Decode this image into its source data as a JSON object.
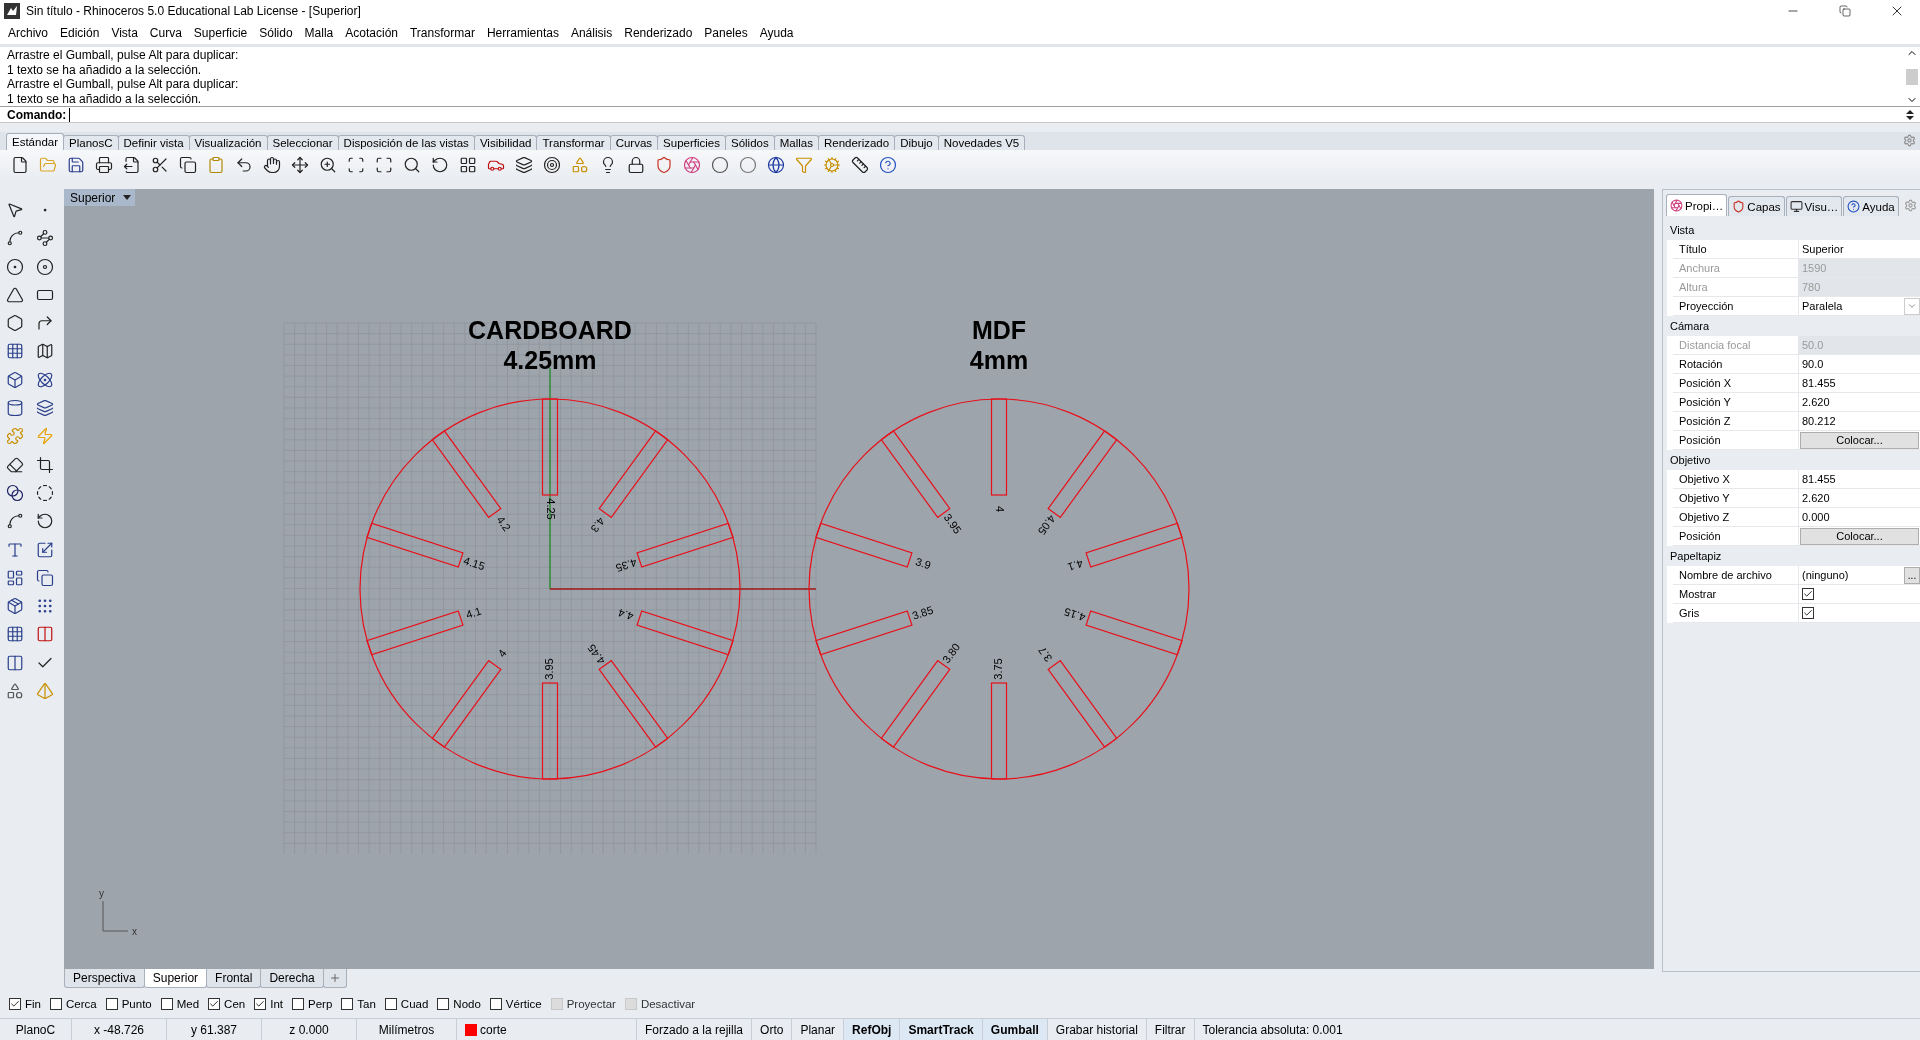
{
  "window": {
    "title": "Sin título - Rhinoceros 5.0 Educational Lab License - [Superior]"
  },
  "menu": [
    "Archivo",
    "Edición",
    "Vista",
    "Curva",
    "Superficie",
    "Sólido",
    "Malla",
    "Acotación",
    "Transformar",
    "Herramientas",
    "Análisis",
    "Renderizado",
    "Paneles",
    "Ayuda"
  ],
  "command_history": [
    "Arrastre el Gumball, pulse Alt para duplicar:",
    "1 texto se ha añadido a la selección.",
    "Arrastre el Gumball, pulse Alt para duplicar:",
    "1 texto se ha añadido a la selección."
  ],
  "command_prompt": "Comando:",
  "toolbar_tabs": [
    {
      "label": "Estándar",
      "selected": true
    },
    {
      "label": "PlanosC",
      "selected": false
    },
    {
      "label": "Definir vista",
      "selected": false
    },
    {
      "label": "Visualización",
      "selected": false
    },
    {
      "label": "Seleccionar",
      "selected": false
    },
    {
      "label": "Disposición de las vistas",
      "selected": false
    },
    {
      "label": "Visibilidad",
      "selected": false
    },
    {
      "label": "Transformar",
      "selected": false
    },
    {
      "label": "Curvas",
      "selected": false
    },
    {
      "label": "Superficies",
      "selected": false
    },
    {
      "label": "Sólidos",
      "selected": false
    },
    {
      "label": "Mallas",
      "selected": false
    },
    {
      "label": "Renderizado",
      "selected": false
    },
    {
      "label": "Dibujo",
      "selected": false
    },
    {
      "label": "Novedades V5",
      "selected": false
    }
  ],
  "viewport": {
    "title": "Superior",
    "axis_labels": {
      "y": "y",
      "x": "x"
    },
    "parts": [
      {
        "name": "CARDBOARD",
        "thickness": "4.25mm",
        "grid": true,
        "slot_labels": [
          "4.25",
          "4.3",
          "4.35",
          "4.4",
          "4.45",
          "3.95",
          "4",
          "4.1",
          "4.15",
          "4.2"
        ]
      },
      {
        "name": "MDF",
        "thickness": "4mm",
        "grid": false,
        "slot_labels": [
          "4",
          "4.05",
          "4.1",
          "4.15",
          "3.7",
          "3.75",
          "3.80",
          "3.85",
          "3.9",
          "3.95"
        ]
      }
    ]
  },
  "viewport_tabs": [
    {
      "label": "Perspectiva",
      "selected": false
    },
    {
      "label": "Superior",
      "selected": true
    },
    {
      "label": "Frontal",
      "selected": false
    },
    {
      "label": "Derecha",
      "selected": false
    }
  ],
  "panel_tabs": [
    {
      "label": "Propi…",
      "selected": true
    },
    {
      "label": "Capas",
      "selected": false
    },
    {
      "label": "Visu…",
      "selected": false
    },
    {
      "label": "Ayuda",
      "selected": false
    }
  ],
  "properties": [
    {
      "title": "Vista",
      "rows": [
        {
          "label": "Título",
          "kind": "text",
          "value": "Superior",
          "disabled": false
        },
        {
          "label": "Anchura",
          "kind": "text",
          "value": "1590",
          "disabled": true
        },
        {
          "label": "Altura",
          "kind": "text",
          "value": "780",
          "disabled": true
        },
        {
          "label": "Proyección",
          "kind": "dropdown",
          "value": "Paralela"
        }
      ]
    },
    {
      "title": "Cámara",
      "rows": [
        {
          "label": "Distancia focal",
          "kind": "text",
          "value": "50.0",
          "disabled": true
        },
        {
          "label": "Rotación",
          "kind": "text",
          "value": "90.0",
          "disabled": false
        },
        {
          "label": "Posición X",
          "kind": "text",
          "value": "81.455",
          "disabled": false
        },
        {
          "label": "Posición Y",
          "kind": "text",
          "value": "2.620",
          "disabled": false
        },
        {
          "label": "Posición Z",
          "kind": "text",
          "value": "80.212",
          "disabled": false
        },
        {
          "label": "Posición",
          "kind": "button",
          "value": "Colocar..."
        }
      ]
    },
    {
      "title": "Objetivo",
      "rows": [
        {
          "label": "Objetivo X",
          "kind": "text",
          "value": "81.455",
          "disabled": false
        },
        {
          "label": "Objetivo Y",
          "kind": "text",
          "value": "2.620",
          "disabled": false
        },
        {
          "label": "Objetivo Z",
          "kind": "text",
          "value": "0.000",
          "disabled": false
        },
        {
          "label": "Posición",
          "kind": "button",
          "value": "Colocar..."
        }
      ]
    },
    {
      "title": "Papeltapiz",
      "rows": [
        {
          "label": "Nombre de archivo",
          "kind": "file",
          "value": "(ninguno)",
          "button": "..."
        },
        {
          "label": "Mostrar",
          "kind": "checkbox",
          "checked": true
        },
        {
          "label": "Gris",
          "kind": "checkbox",
          "checked": true
        }
      ]
    }
  ],
  "osnaps": [
    {
      "label": "Fin",
      "checked": true,
      "disabled": false
    },
    {
      "label": "Cerca",
      "checked": false,
      "disabled": false
    },
    {
      "label": "Punto",
      "checked": false,
      "disabled": false
    },
    {
      "label": "Med",
      "checked": false,
      "disabled": false
    },
    {
      "label": "Cen",
      "checked": true,
      "disabled": false
    },
    {
      "label": "Int",
      "checked": true,
      "disabled": false
    },
    {
      "label": "Perp",
      "checked": false,
      "disabled": false
    },
    {
      "label": "Tan",
      "checked": false,
      "disabled": false
    },
    {
      "label": "Cuad",
      "checked": false,
      "disabled": false
    },
    {
      "label": "Nodo",
      "checked": false,
      "disabled": false
    },
    {
      "label": "Vértice",
      "checked": false,
      "disabled": false
    },
    {
      "label": "Proyectar",
      "checked": false,
      "disabled": true
    },
    {
      "label": "Desactivar",
      "checked": false,
      "disabled": true
    }
  ],
  "status_bar": [
    {
      "kind": "plane",
      "text": "PlanoC"
    },
    {
      "kind": "coordinate",
      "text": "x -48.726"
    },
    {
      "kind": "coordinate",
      "text": "y 61.387"
    },
    {
      "kind": "coordinate",
      "text": "z 0.000"
    },
    {
      "kind": "units",
      "text": "Milímetros"
    },
    {
      "kind": "layer",
      "text": "corte",
      "color": "#ff0000"
    },
    {
      "kind": "toggle",
      "text": "Forzado a la rejilla",
      "on": false
    },
    {
      "kind": "toggle",
      "text": "Orto",
      "on": false
    },
    {
      "kind": "toggle",
      "text": "Planar",
      "on": false
    },
    {
      "kind": "toggle",
      "text": "RefObj",
      "on": true
    },
    {
      "kind": "toggle",
      "text": "SmartTrack",
      "on": true
    },
    {
      "kind": "toggle",
      "text": "Gumball",
      "on": true
    },
    {
      "kind": "toggle",
      "text": "Grabar historial",
      "on": false
    },
    {
      "kind": "toggle",
      "text": "Filtrar",
      "on": false
    },
    {
      "kind": "tolerance",
      "text": "Tolerancia absoluta: 0.001"
    }
  ]
}
